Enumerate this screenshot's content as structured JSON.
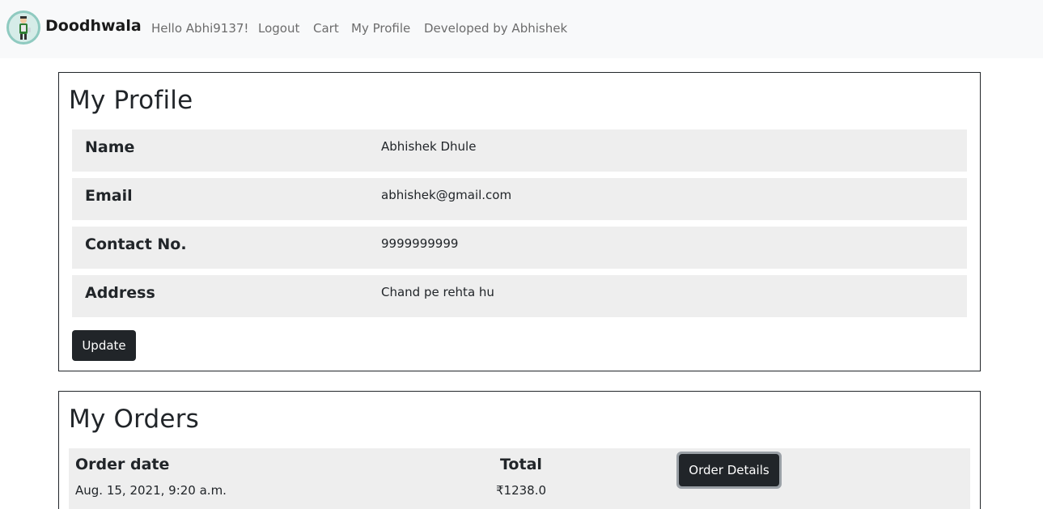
{
  "navbar": {
    "brand": "Doodhwala",
    "greeting": "Hello Abhi9137!",
    "links": [
      "Logout",
      "Cart",
      "My Profile",
      "Developed by Abhishek"
    ]
  },
  "profile": {
    "title": "My Profile",
    "fields": [
      {
        "label": "Name",
        "value": "Abhishek Dhule"
      },
      {
        "label": "Email",
        "value": "abhishek@gmail.com"
      },
      {
        "label": "Contact No.",
        "value": "9999999999"
      },
      {
        "label": "Address",
        "value": "Chand pe rehta hu"
      }
    ],
    "update_label": "Update"
  },
  "orders": {
    "title": "My Orders",
    "headers": {
      "date": "Order date",
      "total": "Total"
    },
    "items": [
      {
        "date": "Aug. 15, 2021, 9:20 a.m.",
        "total": "₹1238.0",
        "details_label": "Order Details"
      }
    ]
  },
  "colors": {
    "navbar_bg": "#f8f9fa",
    "row_bg": "#eeeeee",
    "button_dark": "#212529",
    "link_gray": "#6c6c6c"
  }
}
